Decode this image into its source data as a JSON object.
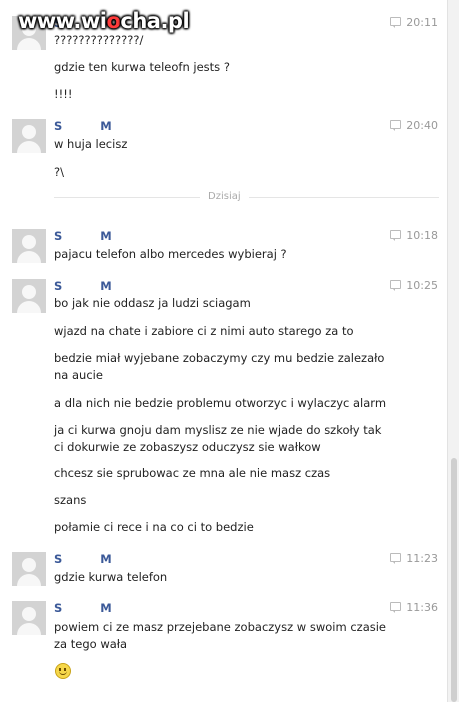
{
  "watermark": {
    "part1": "www.wi",
    "o": "o",
    "part2": "cha.pl"
  },
  "divider_label": "Dzisiaj",
  "messages": [
    {
      "sender_first": "S",
      "sender_last": "M",
      "time": "20:11",
      "lines": [
        "??????????????/",
        "gdzie ten kurwa teleofn jests ?",
        "!!!!"
      ]
    },
    {
      "sender_first": "S",
      "sender_last": "M",
      "time": "20:40",
      "lines": [
        "w huja lecisz",
        "?\\"
      ]
    },
    {
      "sender_first": "S",
      "sender_last": "M",
      "time": "10:18",
      "lines": [
        "pajacu telefon albo mercedes wybieraj ?"
      ]
    },
    {
      "sender_first": "S",
      "sender_last": "M",
      "time": "10:25",
      "lines": [
        "bo jak nie oddasz ja ludzi sciagam",
        "wjazd na chate i zabiore ci z nimi auto starego za to",
        "bedzie miał wyjebane zobaczymy czy mu bedzie zalezało",
        "na aucie",
        "a dla nich nie bedzie problemu otworzyc i wylaczyc alarm",
        "ja ci kurwa gnoju dam myslisz ze nie wjade do szkoły tak",
        "ci dokurwie ze zobaszysz oduczysz sie wałkow",
        "chcesz sie sprubowac ze mna ale nie masz czas",
        "szans",
        "połamie ci rece i na co ci to bedzie"
      ]
    },
    {
      "sender_first": "S",
      "sender_last": "M",
      "time": "11:23",
      "lines": [
        "gdzie kurwa telefon"
      ]
    },
    {
      "sender_first": "S",
      "sender_last": "M",
      "time": "11:36",
      "lines": [
        "powiem ci ze masz przejebane zobaczysz w swoim czasie",
        "za tego wała"
      ],
      "emoticon": "smiley-icon"
    }
  ]
}
